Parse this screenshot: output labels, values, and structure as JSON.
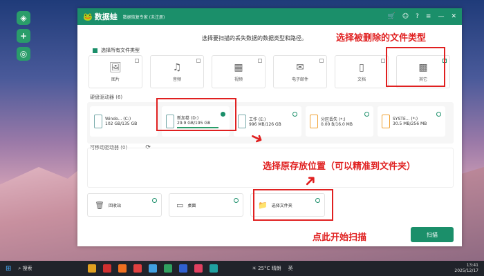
{
  "app": {
    "logo_text": "数据蛙",
    "subtitle": "数据恢复专家 (未注册)"
  },
  "prompt": "选择要扫描的丢失数据的数据类型和路径。",
  "select_all_label": "选择所有文件类型",
  "file_types": [
    {
      "label": "图片",
      "icon": "image-icon"
    },
    {
      "label": "音频",
      "icon": "music-icon"
    },
    {
      "label": "视频",
      "icon": "video-icon"
    },
    {
      "label": "电子邮件",
      "icon": "mail-icon"
    },
    {
      "label": "文档",
      "icon": "document-icon"
    },
    {
      "label": "其它",
      "icon": "other-icon",
      "checked": true
    }
  ],
  "hard_drives_header": "硬盘驱动器 (6)",
  "drives": [
    {
      "name": "Windo... (C:)",
      "size": "102 GB/135 GB"
    },
    {
      "name": "新加卷 (D:)",
      "size": "29.9 GB/195 GB",
      "selected": true
    },
    {
      "name": "工作 (E:)",
      "size": "996 MB/126 GB"
    },
    {
      "name": "分区丢失 (*:)",
      "size": "0.00 B/16.0 MB"
    },
    {
      "name": "SYSTE... (*:)",
      "size": "30.5 MB/256 MB"
    }
  ],
  "removable_header": "可移动驱动器 (0)",
  "locations": [
    {
      "label": "回收站",
      "icon": "recycle-bin-icon"
    },
    {
      "label": "桌面",
      "icon": "desktop-icon"
    },
    {
      "label": "选择文件夹",
      "icon": "folder-icon"
    }
  ],
  "scan_label": "扫描",
  "annotations": {
    "type_note": "选择被删除的文件类型",
    "location_note": "选择原存放位置（可以精准到文件夹）",
    "scan_note": "点此开始扫描"
  },
  "taskbar": {
    "search": "搜索",
    "weather": "25°C 晴朗",
    "ime": "英",
    "time": "13:41",
    "date": "2025/12/17"
  },
  "colors": {
    "brand": "#1b8f6a",
    "annotation": "#e02020"
  }
}
